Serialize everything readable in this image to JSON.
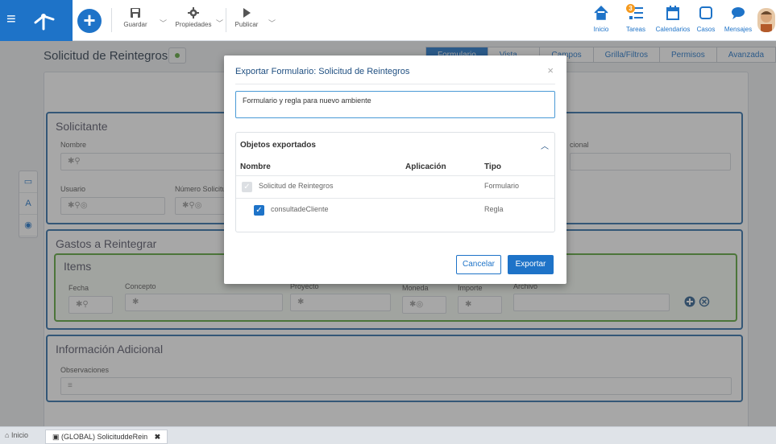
{
  "toolbar": {
    "save_label": "Guardar",
    "properties_label": "Propiedades",
    "publish_label": "Publicar"
  },
  "nav": {
    "home_label": "Inicio",
    "tasks_label": "Tareas",
    "tasks_badge": "3",
    "calendars_label": "Calendarios",
    "cases_label": "Casos",
    "messages_label": "Mensajes"
  },
  "form": {
    "title": "Solicitud de Reintegros",
    "tabs": [
      "Formulario",
      "Vista Previa",
      "Campos",
      "Grilla/Filtros",
      "Permisos",
      "Avanzada"
    ],
    "active_tab": "Formulario"
  },
  "sections": {
    "solicitante": {
      "title": "Solicitante",
      "nombre_label": "Nombre",
      "nombre_value": "✱⚲",
      "usuario_label": "Usuario",
      "usuario_value": "✱⚲◎",
      "numero_label": "Número Solicitu",
      "numero_value": "✱⚲◎",
      "right_label": "cional"
    },
    "gastos": {
      "title": "Gastos a Reintegrar",
      "items_title": "Items",
      "fecha_label": "Fecha",
      "fecha_value": "✱⚲",
      "concepto_label": "Concepto",
      "concepto_value": "✱",
      "proyecto_label": "Proyecto",
      "proyecto_value": "✱",
      "moneda_label": "Moneda",
      "moneda_value": "✱◎",
      "importe_label": "Importe",
      "importe_value": "✱",
      "archivo_label": "Archivo"
    },
    "info": {
      "title": "Información Adicional",
      "obs_label": "Observaciones",
      "obs_value": "≡"
    }
  },
  "left_tools": [
    "▭",
    "A",
    "◉"
  ],
  "bottom": {
    "home_label": "Inicio",
    "tab_label": "(GLOBAL) SolicituddeRein"
  },
  "modal": {
    "title": "Exportar Formulario: Solicitud de Reintegros",
    "close": "×",
    "description": "Formulario y regla para nuevo ambiente",
    "panel_title": "Objetos exportados",
    "col_name": "Nombre",
    "col_app": "Aplicación",
    "col_type": "Tipo",
    "rows": [
      {
        "name": "Solicitud de Reintegros",
        "app": "",
        "type": "Formulario"
      },
      {
        "name": "consultadeCliente",
        "app": "",
        "type": "Regla"
      }
    ],
    "cancel_label": "Cancelar",
    "export_label": "Exportar"
  },
  "colors": {
    "brand": "#1e73c8",
    "section_border": "#2f6ea8",
    "items_border": "#5aa53a",
    "badge": "#f59a1e"
  }
}
